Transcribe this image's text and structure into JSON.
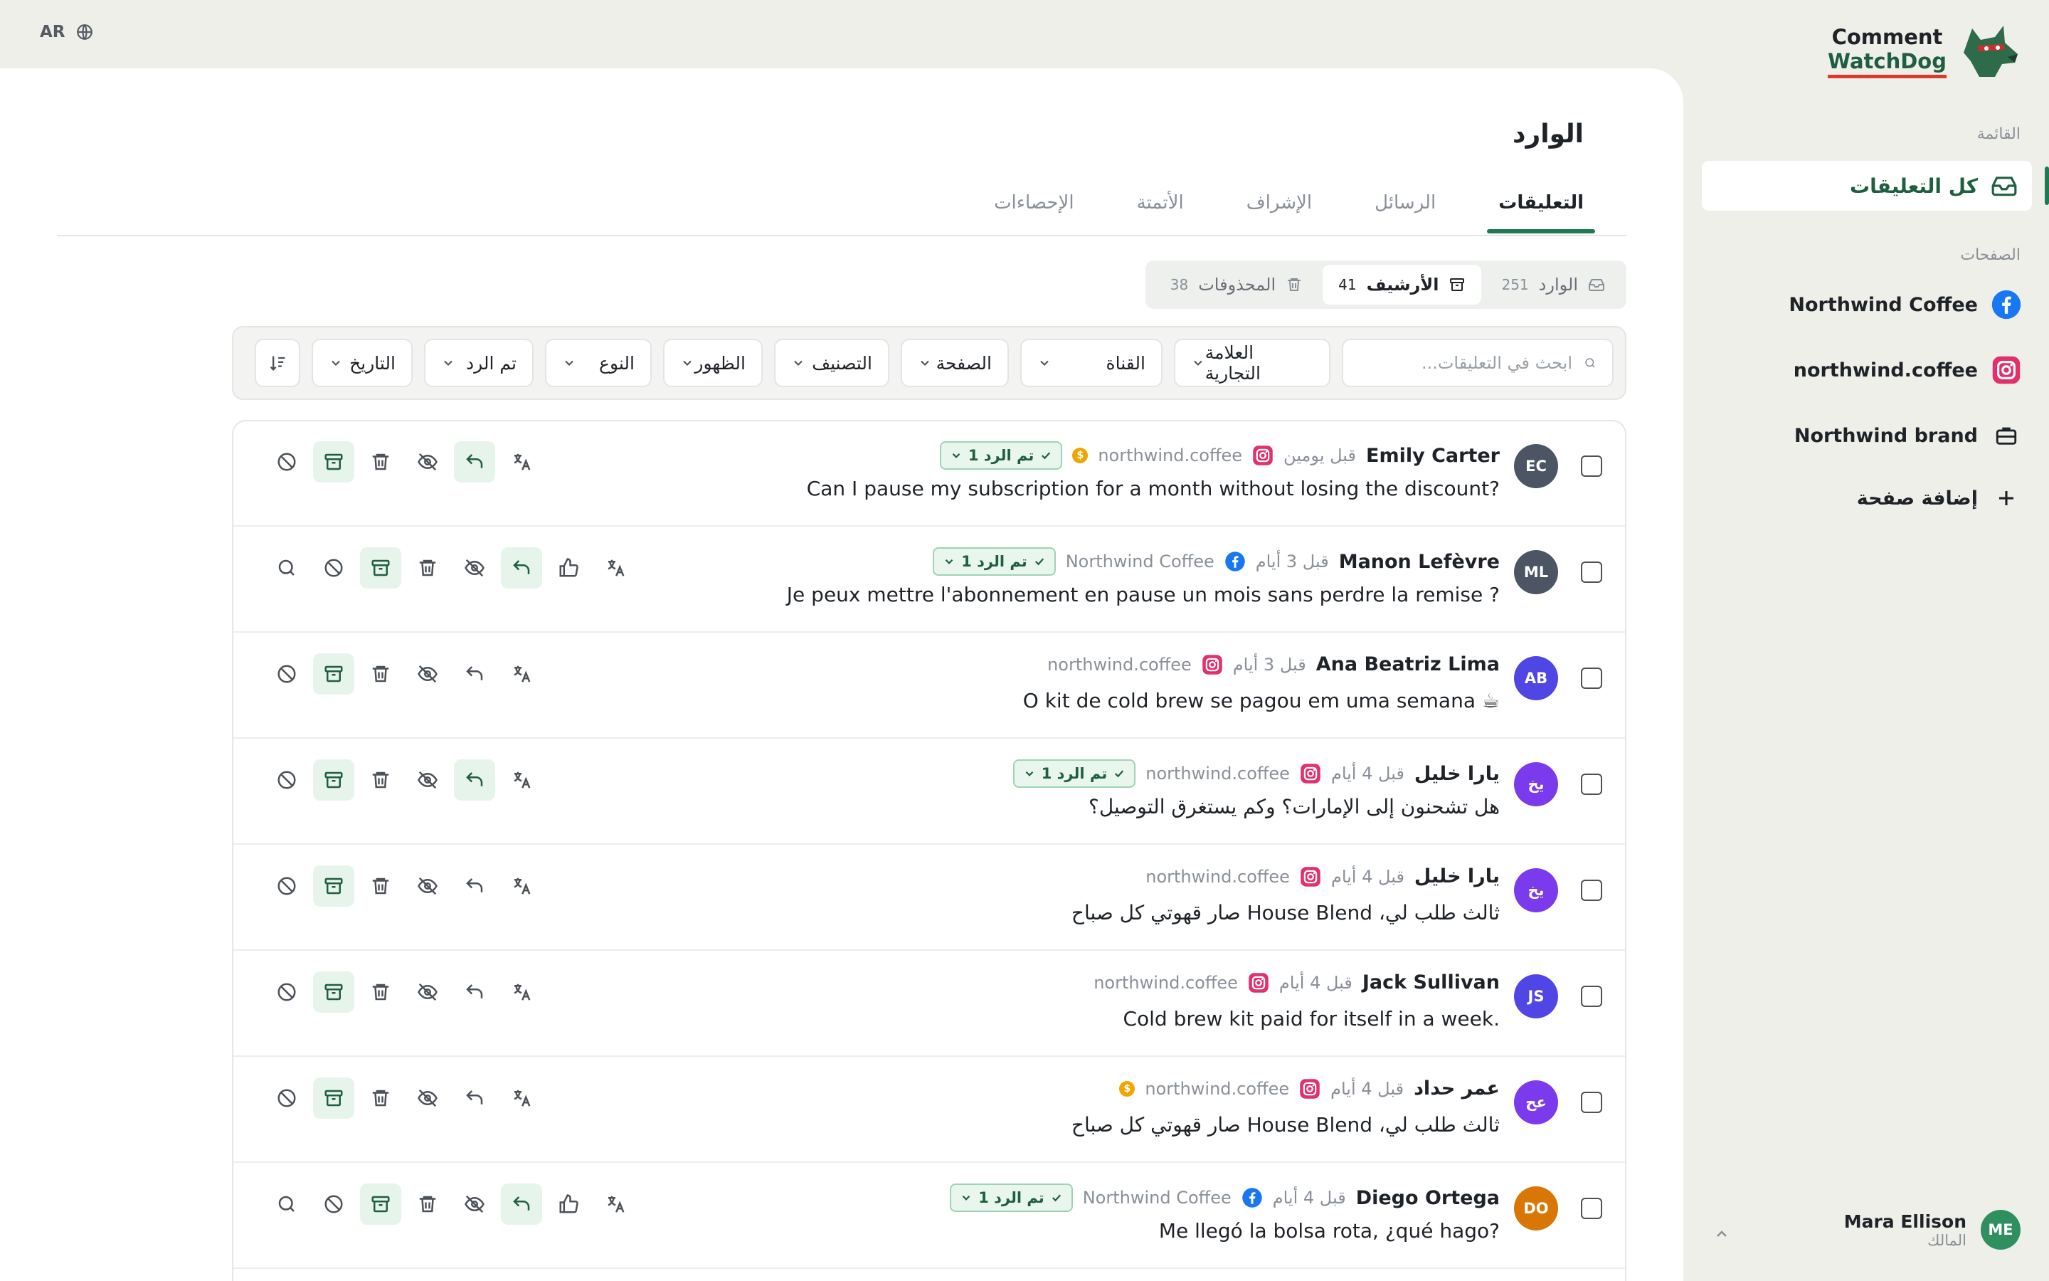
{
  "lang": {
    "code": "AR"
  },
  "brand": {
    "line1": "Comment",
    "line2": "WatchDog"
  },
  "sidebar": {
    "menu_label": "القائمة",
    "all_comments": "كل التعليقات",
    "pages_label": "الصفحات",
    "pages": [
      {
        "label": "Northwind Coffee",
        "icon": "facebook-icon"
      },
      {
        "label": "northwind.coffee",
        "icon": "instagram-icon"
      },
      {
        "label": "Northwind brand",
        "icon": "briefcase-icon"
      }
    ],
    "add_page": "إضافة صفحة",
    "user": {
      "initials": "ME",
      "name": "Mara Ellison",
      "role": "المالك"
    }
  },
  "main": {
    "title": "الوارد",
    "tabs": [
      "التعليقات",
      "الرسائل",
      "الإشراف",
      "الأتمتة",
      "الإحصاءات"
    ],
    "active_tab": 0,
    "segments": [
      {
        "label": "الوارد",
        "count": "251",
        "icon": "inbox-icon"
      },
      {
        "label": "الأرشيف",
        "count": "41",
        "icon": "archive-icon"
      },
      {
        "label": "المحذوفات",
        "count": "38",
        "icon": "trash-icon"
      }
    ],
    "active_segment": 1
  },
  "filters": {
    "search_placeholder": "ابحث في التعليقات...",
    "brand": "العلامة التجارية",
    "channel": "القناة",
    "page": "الصفحة",
    "category": "التصنيف",
    "visibility": "الظهور",
    "type": "النوع",
    "replied": "تم الرد",
    "date": "التاريخ"
  },
  "comments": [
    {
      "initials": "EC",
      "avatar_color": "#4b5563",
      "name": "Emily Carter",
      "time": "قبل يومين",
      "platform": "instagram",
      "page": "northwind.coffee",
      "coin": true,
      "badge": "تم الرد 1",
      "text": "Can I pause my subscription for a month without losing the discount?",
      "extended": false,
      "reply_active": true
    },
    {
      "initials": "ML",
      "avatar_color": "#4b5563",
      "name": "Manon Lefèvre",
      "time": "قبل 3 أيام",
      "platform": "facebook",
      "page": "Northwind Coffee",
      "coin": false,
      "badge": "تم الرد 1",
      "text": "Je peux mettre l'abonnement en pause un mois sans perdre la remise ?",
      "extended": true,
      "reply_active": true
    },
    {
      "initials": "AB",
      "avatar_color": "#4f46e5",
      "name": "Ana Beatriz Lima",
      "time": "قبل 3 أيام",
      "platform": "instagram",
      "page": "northwind.coffee",
      "coin": false,
      "badge": "",
      "text": "O kit de cold brew se pagou em uma semana ☕",
      "extended": false,
      "reply_active": false
    },
    {
      "initials": "يخ",
      "avatar_color": "#7c3aed",
      "name": "يارا خليل",
      "time": "قبل 4 أيام",
      "platform": "instagram",
      "page": "northwind.coffee",
      "coin": false,
      "badge": "تم الرد 1",
      "text": "هل تشحنون إلى الإمارات؟ وكم يستغرق التوصيل؟",
      "extended": false,
      "reply_active": true
    },
    {
      "initials": "يخ",
      "avatar_color": "#7c3aed",
      "name": "يارا خليل",
      "time": "قبل 4 أيام",
      "platform": "instagram",
      "page": "northwind.coffee",
      "coin": false,
      "badge": "",
      "text": "ثالث طلب لي، House Blend صار قهوتي كل صباح",
      "extended": false,
      "reply_active": false
    },
    {
      "initials": "JS",
      "avatar_color": "#4f46e5",
      "name": "Jack Sullivan",
      "time": "قبل 4 أيام",
      "platform": "instagram",
      "page": "northwind.coffee",
      "coin": false,
      "badge": "",
      "text": "Cold brew kit paid for itself in a week.",
      "extended": false,
      "reply_active": false
    },
    {
      "initials": "عح",
      "avatar_color": "#7c3aed",
      "name": "عمر حداد",
      "time": "قبل 4 أيام",
      "platform": "instagram",
      "page": "northwind.coffee",
      "coin": true,
      "badge": "",
      "text": "ثالث طلب لي، House Blend صار قهوتي كل صباح",
      "extended": false,
      "reply_active": false
    },
    {
      "initials": "DO",
      "avatar_color": "#d97706",
      "name": "Diego Ortega",
      "time": "قبل 4 أيام",
      "platform": "facebook",
      "page": "Northwind Coffee",
      "coin": false,
      "badge": "تم الرد 1",
      "text": "Me llegó la bolsa rota, ¿qué hago?",
      "extended": true,
      "reply_active": true
    }
  ]
}
